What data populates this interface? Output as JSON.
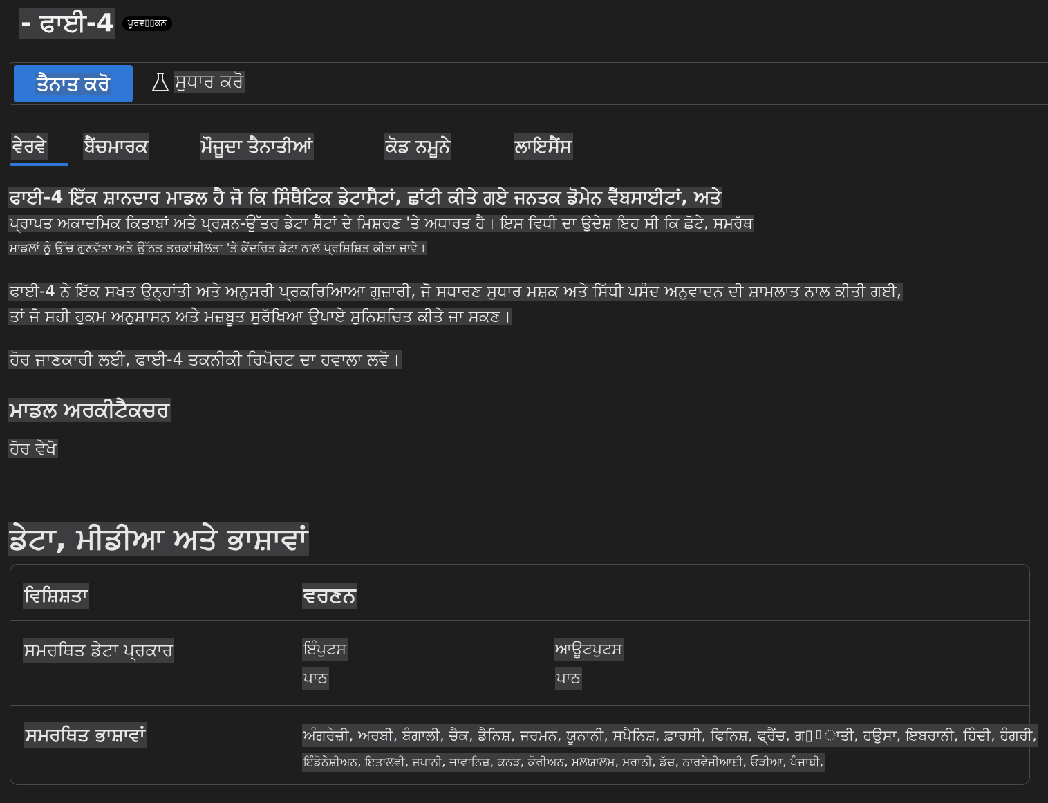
{
  "header": {
    "title": "- ਫਾਈ-4",
    "badge": "ਪੂਰਵ▯▯ਕਨ"
  },
  "toolbar": {
    "deploy_label": "ਤੈਨਾਤ ਕਰੋ",
    "improve_icon": "flask-icon",
    "improve_label": "ਸੁਧਾਰ ਕਰੋ"
  },
  "tabs": [
    {
      "label": "ਵੇਰਵੇ",
      "active": true
    },
    {
      "label": "ਬੈਂਚਮਾਰਕ",
      "active": false
    },
    {
      "label": "ਮੌਜੂਦਾ ਤੈਨਾਤੀਆਂ",
      "active": false
    },
    {
      "label": "ਕੋਡ ਨਮੂਨੇ",
      "active": false
    },
    {
      "label": "ਲਾਇਸੈਂਸ",
      "active": false
    }
  ],
  "content": {
    "para1_line1": "ਫਾਈ-4 ਇੱਕ ਸ਼ਾਨਦਾਰ ਮਾਡਲ ਹੈ ਜੋ ਕਿ ਸਿੰਥੈਟਿਕ ਡੇਟਾਸੈੱਟਾਂ, ਛਾਂਟੀ ਕੀਤੇ ਗਏ ਜਨਤਕ ਡੋਮੇਨ ਵੈੱਬਸਾਈਟਾਂ, ਅਤੇ",
    "para1_line2": "ਪ੍ਰਾਪਤ ਅਕਾਦਮਿਕ ਕਿਤਾਬਾਂ ਅਤੇ ਪ੍ਰਸ਼ਨ-ਉੱਤਰ ਡੇਟਾ ਸੈੱਟਾਂ ਦੇ ਮਿਸ਼ਰਣ 'ਤੇ ਅਧਾਰਤ ਹੈ। ਇਸ ਵਿਧੀ ਦਾ ਉਦੇਸ਼ ਇਹ ਸੀ ਕਿ ਛੋਟੇ, ਸਮਰੱਥ",
    "para1_line3": "ਮਾਡਲਾਂ ਨੂੰ ਉੱਚ ਗੁਣਵੱਤਾ ਅਤੇ ਉੱਨਤ ਤਰਕਾਂਸ਼ੀਲਤਾ 'ਤੇ ਕੇਂਦਰਿਤ ਡੇਟਾ ਨਾਲ ਪ੍ਰਸ਼ਿਸ਼ਿਤ ਕੀਤਾ ਜਾਵੇ।",
    "para2_line1": "ਫਾਈ-4 ਨੇ ਇੱਕ ਸਖਤ ਉਨ੍ਹਾਂਤੀ ਅਤੇ ਅਨੁਸਰੀ ਪ੍ਰਕਰਿਆਿਆ ਗੁਜ਼ਾਰੀ, ਜੋ ਸਧਾਰਣ ਸੁਧਾਰ ਮਸ਼ਕ ਅਤੇ ਸਿੱਧੀ ਪਸੰਦ ਅਨੁਵਾਦਨ ਦੀ ਸ਼ਾਮਲਾਤ ਨਾਲ ਕੀਤੀ ਗਈ,",
    "para2_line2": "ਤਾਂ ਜੋ ਸਹੀ ਹੁਕਮ ਅਨੁਸ਼ਾਸਨ ਅਤੇ ਮਜ਼ਬੂਤ ਸੁਰੱਖਿਆ ਉਪਾਏ ਸੁਨਿਸ਼ਚਿਤ ਕੀਤੇ ਜਾ ਸਕਣ।",
    "para3": "ਹੋਰ ਜਾਣਕਾਰੀ ਲਈ, ਫਾਈ-4 ਤਕਨੀਕੀ ਰਿਪੋਰਟ ਦਾ ਹਵਾਲਾ ਲਵੋ।",
    "arch_heading": "ਮਾਡਲ ਅਰਕੀਟੈਕਚਰ",
    "see_more": "ਹੋਰ ਵੇਖੋ",
    "data_heading": "ਡੇਟਾ, ਮੀਡੀਆ ਅਤੇ ਭਾਸ਼ਾਵਾਂ"
  },
  "table": {
    "header_feature": "ਵਿਸ਼ਿਸ਼ਤਾ",
    "header_description": "ਵਰਣਨ",
    "row1_key": "ਸਮਰਥਿਤ ਡੇਟਾ ਪ੍ਰਕਾਰ",
    "inputs_label": "ਇੰਪੁਟਸ",
    "inputs_value": "ਪਾਠ",
    "outputs_label": "ਆਊਟਪੁਟਸ",
    "outputs_value": "ਪਾਠ",
    "row2_key": "ਸਮਰਥਿਤ ਭਾਸ਼ਾਵਾਂ",
    "languages_line1": "ਅੰਗਰੇਜ਼ੀ, ਅਰਬੀ, ਬੰਗਾਲੀ, ਚੈਕ, ਡੈਨਿਸ਼, ਜਰਮਨ, ਯੂਨਾਨੀ, ਸਪੈਨਿਸ਼, ਫ਼ਾਰਸੀ, ਫਿਨਿਸ਼, ਫ੍ਰੈਂਚ, ਗ▯▯ਾਤੀ, ਹਉਸਾ, ਇਬਰਾਨੀ, ਹਿੰਦੀ, ਹੰਗਰੀ,",
    "languages_line2": "ਇੰਡੋਨੇਸ਼ੀਅਨ, ਇਤਾਲਵੀ, ਜਪਾਨੀ, ਜਾਵਾਨਿਜ਼, ਕਨੜ, ਕੋਰੀਅਨ, ਮਲਯਾਲਮ, ਮਰਾਠੀ, ਡੱਚ, ਨਾਰਵੇਜੀਆਈ, ਓੜੀਆ, ਪੰਜਾਬੀ,"
  },
  "colors": {
    "background": "#1e1e1f",
    "accent": "#2f78d8",
    "text_highlight": "#3d3d3f",
    "border": "#4a4a4a"
  }
}
